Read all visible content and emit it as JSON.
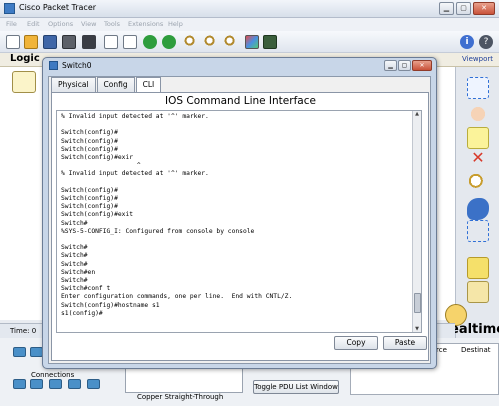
{
  "app": {
    "title": "Cisco Packet Tracer"
  },
  "menu": [
    "File",
    "Edit",
    "Options",
    "View",
    "Tools",
    "Extensions",
    "Help"
  ],
  "workspace": {
    "logical_tab": "Logic",
    "viewport_label": "Viewport"
  },
  "mode": {
    "realtime_label": "Realtime",
    "time_label": "Time: 0"
  },
  "bottom": {
    "connection_label": "Connections",
    "cable_label": "Copper Straight-Through",
    "toggle_pdu_label": "Toggle PDU List Window",
    "pdu_columns": [
      "rce",
      "Destinat"
    ]
  },
  "dialog": {
    "title": "Switch0",
    "tabs": [
      "Physical",
      "Config",
      "CLI"
    ],
    "active_tab": "CLI",
    "heading": "IOS Command Line Interface",
    "terminal_lines": [
      "% Invalid input detected at '^' marker.",
      "",
      "Switch(config)#",
      "Switch(config)#",
      "Switch(config)#",
      "Switch(config)#exir",
      "                    ^",
      "% Invalid input detected at '^' marker.",
      "",
      "Switch(config)#",
      "Switch(config)#",
      "Switch(config)#",
      "Switch(config)#exit",
      "Switch#",
      "%SYS-5-CONFIG_I: Configured from console by console",
      "",
      "Switch#",
      "Switch#",
      "Switch#",
      "Switch#en",
      "Switch#",
      "Switch#conf t",
      "Enter configuration commands, one per line.  End with CNTL/Z.",
      "Switch(config)#hostname s1",
      "s1(config)#"
    ],
    "copy_label": "Copy",
    "paste_label": "Paste"
  }
}
